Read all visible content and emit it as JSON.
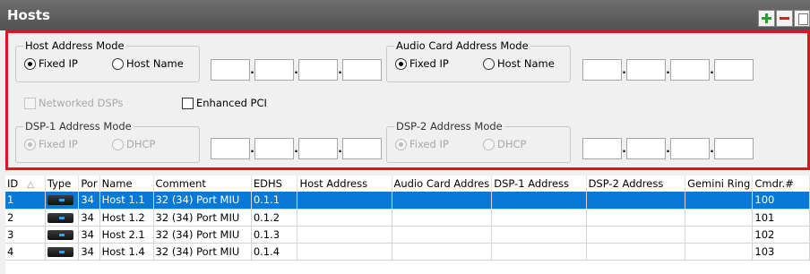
{
  "header": {
    "title": "Hosts",
    "add_icon": "plus-icon",
    "remove_icon": "minus-icon"
  },
  "colors": {
    "highlight_frame": "#e0141c",
    "selection": "#0a78d7",
    "add_green": "#2e9a2e",
    "remove_red": "#d42020"
  },
  "form": {
    "host_mode": {
      "legend": "Host Address Mode",
      "option_fixed": "Fixed IP",
      "option_name": "Host Name",
      "selected": "Fixed IP"
    },
    "audio_mode": {
      "legend": "Audio Card Address Mode",
      "option_fixed": "Fixed IP",
      "option_name": "Host Name",
      "selected": "Fixed IP"
    },
    "networked_dsps": {
      "label": "Networked DSPs",
      "checked": false,
      "enabled": false
    },
    "enhanced_pci": {
      "label": "Enhanced PCI",
      "checked": false,
      "enabled": true
    },
    "dsp1_mode": {
      "legend": "DSP-1 Address Mode",
      "option_fixed": "Fixed IP",
      "option_dhcp": "DHCP",
      "selected": "Fixed IP",
      "enabled": false
    },
    "dsp2_mode": {
      "legend": "DSP-2 Address Mode",
      "option_fixed": "Fixed IP",
      "option_dhcp": "DHCP",
      "selected": "Fixed IP",
      "enabled": false
    },
    "ip_separator": "."
  },
  "table": {
    "columns": [
      "ID",
      "Type",
      "Por",
      "Name",
      "Comment",
      "EDHS",
      "Host Address",
      "Audio Card Addres",
      "DSP-1 Address",
      "DSP-2 Address",
      "Gemini Ring",
      "Cmdr.#"
    ],
    "sort_indicator": "△",
    "type_icon": "device-chassis-icon",
    "rows": [
      {
        "id": "1",
        "port": "34",
        "name": "Host 1.1",
        "comment": "32 (34) Port MIU",
        "edhs": "0.1.1",
        "host_address": "",
        "audio_card_address": "",
        "dsp1_address": "",
        "dsp2_address": "",
        "gemini_ring": "",
        "cmdr": "100",
        "selected": true
      },
      {
        "id": "2",
        "port": "34",
        "name": "Host 1.2",
        "comment": "32 (34) Port MIU",
        "edhs": "0.1.2",
        "host_address": "",
        "audio_card_address": "",
        "dsp1_address": "",
        "dsp2_address": "",
        "gemini_ring": "",
        "cmdr": "101",
        "selected": false
      },
      {
        "id": "3",
        "port": "34",
        "name": "Host 2.1",
        "comment": "32 (34) Port MIU",
        "edhs": "0.1.3",
        "host_address": "",
        "audio_card_address": "",
        "dsp1_address": "",
        "dsp2_address": "",
        "gemini_ring": "",
        "cmdr": "102",
        "selected": false
      },
      {
        "id": "4",
        "port": "34",
        "name": "Host 1.4",
        "comment": "32 (34) Port MIU",
        "edhs": "0.1.4",
        "host_address": "",
        "audio_card_address": "",
        "dsp1_address": "",
        "dsp2_address": "",
        "gemini_ring": "",
        "cmdr": "103",
        "selected": false
      }
    ]
  }
}
